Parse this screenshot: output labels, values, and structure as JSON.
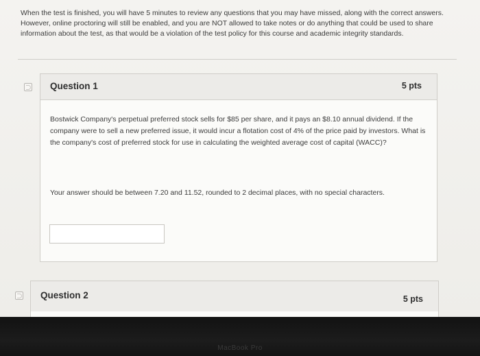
{
  "intro": {
    "text": "When the test is finished, you will have 5 minutes to review any questions that you may have missed, along with the correct answers. However, online proctoring will still be enabled, and you are NOT allowed to take notes or do anything that could be used to share information about the test, as that would be a violation of the test policy for this course and academic integrity standards."
  },
  "questions": [
    {
      "title": "Question 1",
      "points": "5 pts",
      "text": "Bostwick Company's perpetual preferred stock sells for $85 per share, and it pays an $8.10 annual dividend. If the company were to sell a new preferred issue, it would incur a flotation cost of 4% of the price paid by investors. What is the company's cost of preferred stock for use in calculating the weighted average cost of capital (WACC)?",
      "hint": "Your answer should be between 7.20 and 11.52, rounded to 2 decimal places, with no special characters.",
      "answer_value": ""
    },
    {
      "title": "Question 2",
      "points": "5 pts"
    }
  ],
  "device": {
    "brand": "MacBook Pro"
  }
}
